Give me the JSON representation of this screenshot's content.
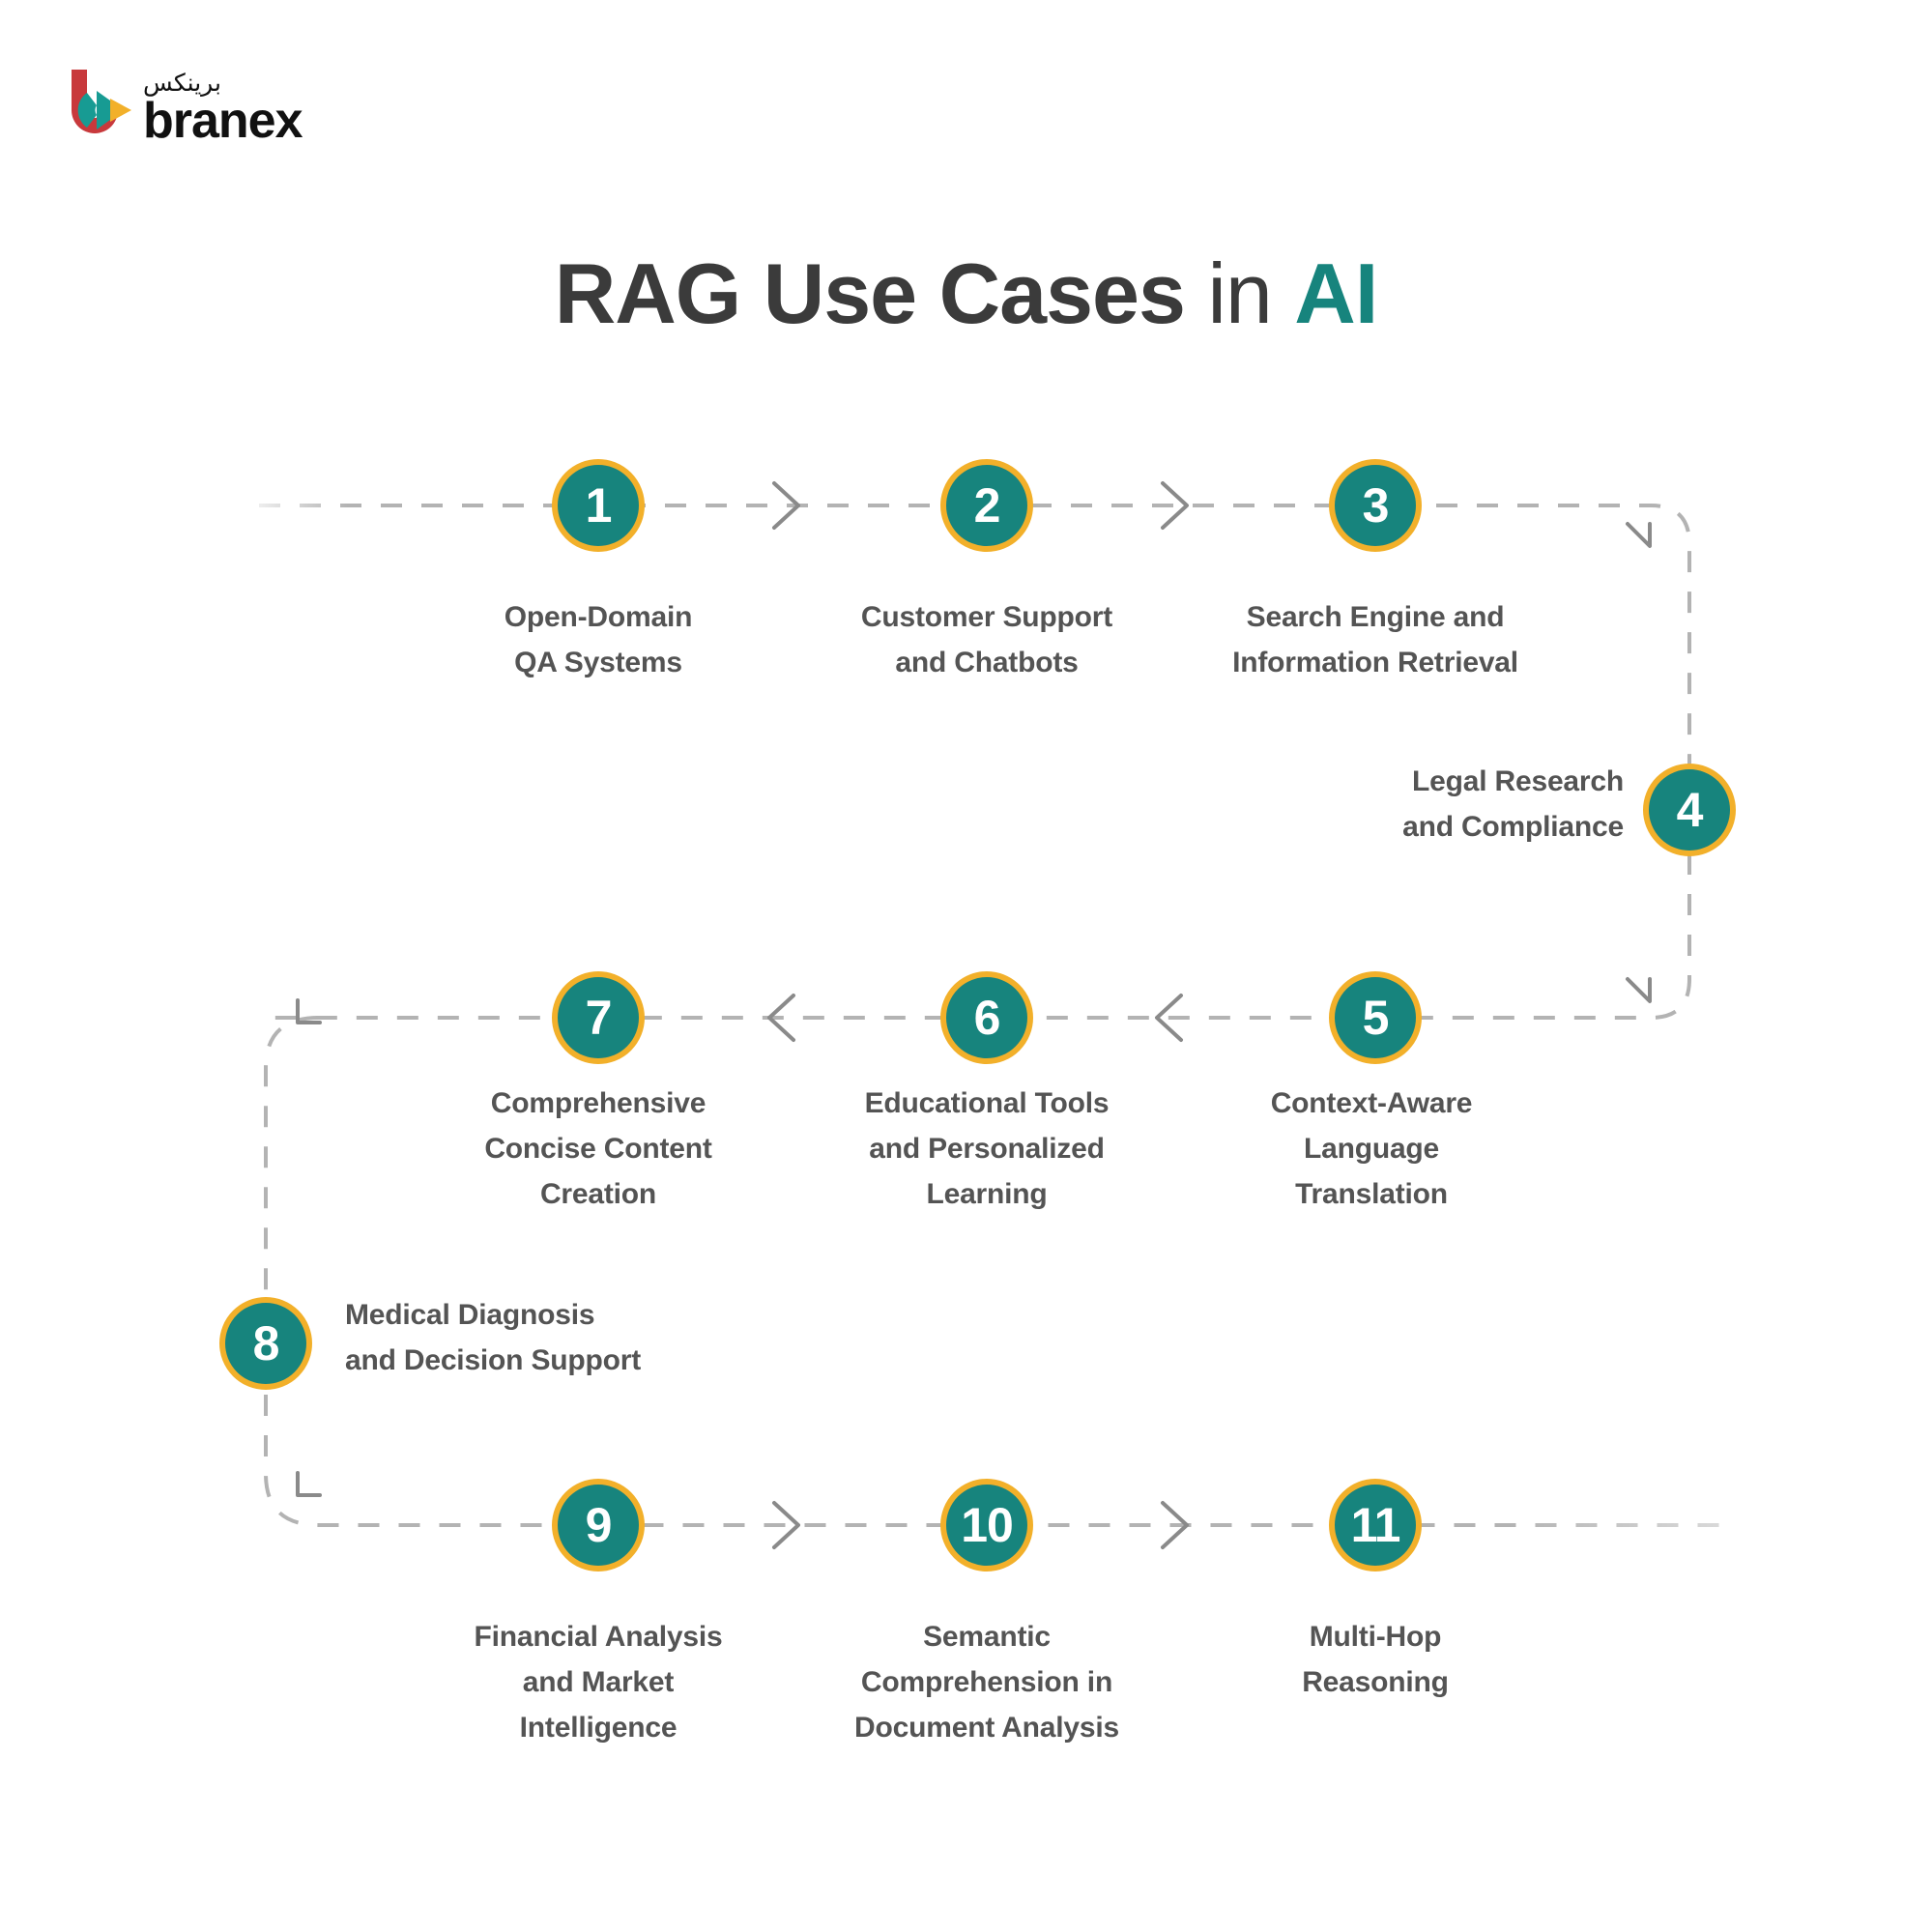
{
  "brand": {
    "name": "branex",
    "arabic_name": "برينكس",
    "logo_icon": "branex-logo-icon",
    "colors": {
      "red": "#c8393c",
      "teal": "#179b93",
      "yellow": "#f2b02a"
    }
  },
  "title": {
    "part1": "RAG Use Cases",
    "part2": "in",
    "part3": "AI",
    "accent_color": "#17847d",
    "text_color": "#3b3b3b"
  },
  "theme": {
    "background": "#ffffff",
    "node_fill": "#17847d",
    "node_ring": "#f2b02a",
    "node_number_color": "#ffffff",
    "label_color": "#545454",
    "connector_color": "#b3b3b3",
    "arrow_color": "#8a8a8a"
  },
  "flow": {
    "direction_row1": "left-to-right",
    "direction_row2": "right-to-left",
    "direction_row3": "left-to-right",
    "steps": [
      {
        "number": "1",
        "label_line1": "Open-Domain",
        "label_line2": "QA Systems",
        "label_line3": ""
      },
      {
        "number": "2",
        "label_line1": "Customer Support",
        "label_line2": "and Chatbots",
        "label_line3": ""
      },
      {
        "number": "3",
        "label_line1": "Search Engine and",
        "label_line2": "Information Retrieval",
        "label_line3": ""
      },
      {
        "number": "4",
        "label_line1": "Legal Research",
        "label_line2": "and Compliance",
        "label_line3": ""
      },
      {
        "number": "5",
        "label_line1": "Context-Aware",
        "label_line2": "Language",
        "label_line3": "Translation"
      },
      {
        "number": "6",
        "label_line1": "Educational Tools",
        "label_line2": "and Personalized",
        "label_line3": "Learning"
      },
      {
        "number": "7",
        "label_line1": "Comprehensive",
        "label_line2": "Concise Content",
        "label_line3": "Creation"
      },
      {
        "number": "8",
        "label_line1": "Medical Diagnosis",
        "label_line2": "and Decision Support",
        "label_line3": ""
      },
      {
        "number": "9",
        "label_line1": "Financial Analysis",
        "label_line2": "and Market",
        "label_line3": "Intelligence"
      },
      {
        "number": "10",
        "label_line1": "Semantic",
        "label_line2": "Comprehension in",
        "label_line3": "Document Analysis"
      },
      {
        "number": "11",
        "label_line1": "Multi-Hop",
        "label_line2": "Reasoning",
        "label_line3": ""
      }
    ]
  }
}
